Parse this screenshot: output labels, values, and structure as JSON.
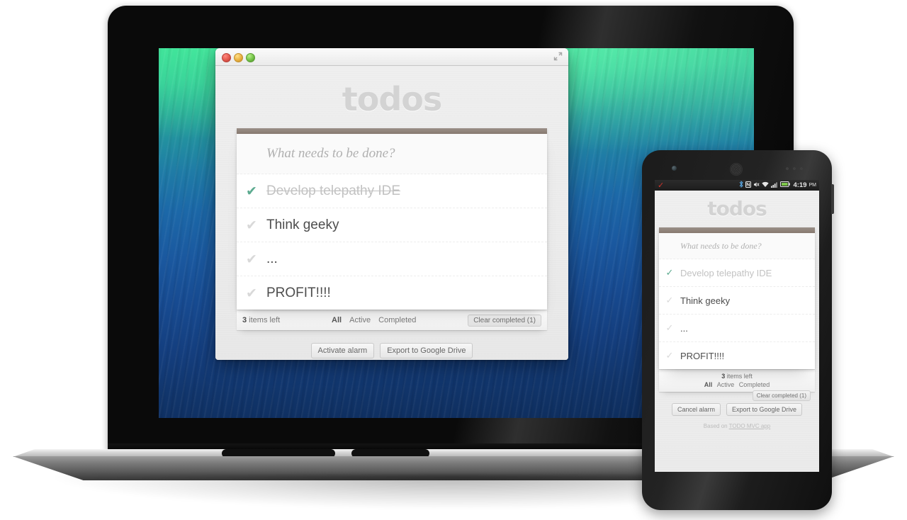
{
  "app": {
    "title": "todos",
    "new_todo_placeholder": "What needs to be done?",
    "credit_prefix": "Based on ",
    "credit_link": "TODO MVC app"
  },
  "todos": [
    {
      "text": "Develop telepathy IDE",
      "completed": true
    },
    {
      "text": "Think geeky",
      "completed": false
    },
    {
      "text": "...",
      "completed": false
    },
    {
      "text": "PROFIT!!!!",
      "completed": false
    }
  ],
  "footer": {
    "count": "3",
    "count_suffix": " items left",
    "filters": [
      {
        "label": "All",
        "selected": true
      },
      {
        "label": "Active",
        "selected": false
      },
      {
        "label": "Completed",
        "selected": false
      }
    ],
    "clear_completed": "Clear completed (1)"
  },
  "desktop": {
    "alarm_button": "Activate alarm",
    "export_button": "Export to Google Drive"
  },
  "phone": {
    "alarm_button": "Cancel alarm",
    "export_button": "Export to Google Drive",
    "status_bar": {
      "notification_icon": "✓",
      "bluetooth_icon": "✻",
      "nfc_icon": "N",
      "mute_icon": "✗",
      "wifi_icon": "▲",
      "signal_icon": "▮",
      "battery_icon": "▭",
      "time": "4:19",
      "ampm": "PM"
    }
  },
  "colors": {
    "accent_check": "#5dab90",
    "card_topbar": "#87796f",
    "title_grey": "#d3d3d3",
    "battery_green": "#7ec64a",
    "notification_red": "#d0342c"
  }
}
